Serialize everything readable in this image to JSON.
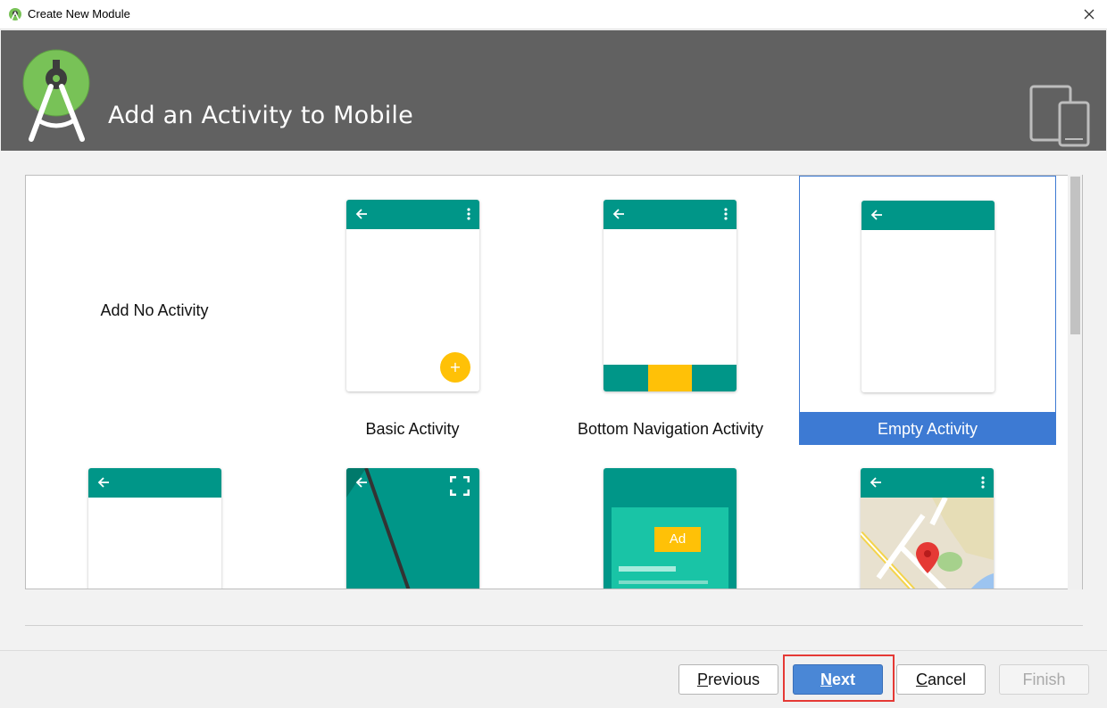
{
  "window": {
    "title": "Create New Module",
    "close_icon": "close-icon",
    "app_icon": "android-studio-icon"
  },
  "header": {
    "title": "Add an Activity to Mobile",
    "logo_icon": "android-studio-logo",
    "form_factor_icon": "tablet-phone-icon"
  },
  "templates": {
    "items": [
      {
        "label": "Add No Activity"
      },
      {
        "label": "Basic Activity"
      },
      {
        "label": "Bottom Navigation Activity"
      },
      {
        "label": "Empty Activity",
        "selected": true
      },
      {
        "label": ""
      },
      {
        "label": ""
      },
      {
        "label": ""
      },
      {
        "label": ""
      }
    ],
    "fab_symbol": "+",
    "ad_label": "Ad"
  },
  "buttons": {
    "previous": {
      "mnemonic": "P",
      "rest": "revious"
    },
    "next": {
      "mnemonic": "N",
      "rest": "ext"
    },
    "cancel": {
      "mnemonic": "C",
      "rest": "ancel"
    },
    "finish": "Finish"
  },
  "colors": {
    "accent": "#009688",
    "selection": "#3d7ad3",
    "fab": "#ffc107",
    "banner": "#616161"
  }
}
